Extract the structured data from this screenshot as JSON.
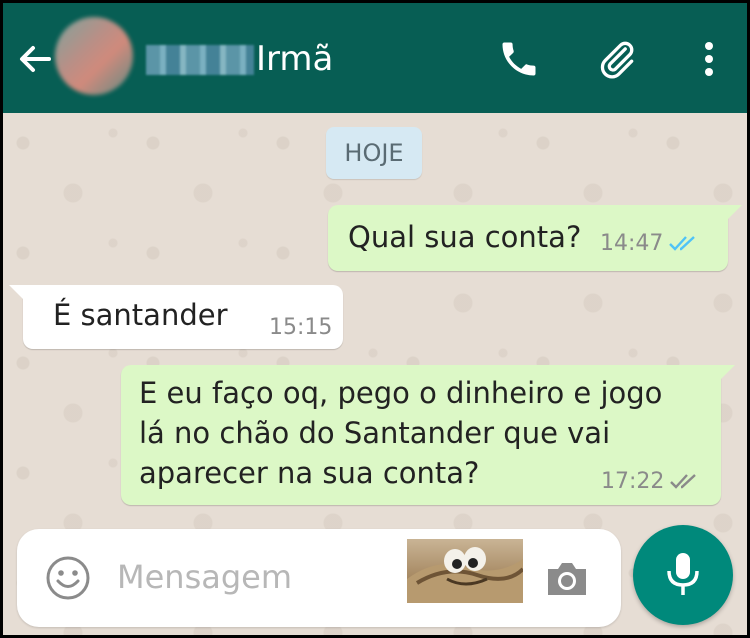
{
  "header": {
    "contact_name": "Irmã",
    "back_icon": "back-arrow-icon",
    "actions": [
      "phone-icon",
      "paperclip-icon",
      "more-vert-icon"
    ],
    "background": "#075e54"
  },
  "chat": {
    "date_label": "HOJE",
    "messages": [
      {
        "direction": "outgoing",
        "text": "Qual sua conta?",
        "time": "14:47",
        "status": "read"
      },
      {
        "direction": "incoming",
        "text": "É  santander",
        "time": "15:15"
      },
      {
        "direction": "outgoing",
        "text": "E eu faço oq, pego o dinheiro e jogo\nlá no chão do Santander que vai\naparecer na sua conta?",
        "time": "17:22",
        "status": "delivered"
      }
    ]
  },
  "composer": {
    "placeholder": "Mensagem",
    "value": "",
    "icons": [
      "emoji-icon",
      "camera-icon",
      "mic-icon"
    ]
  },
  "colors": {
    "outgoing_bubble": "#dcf8c6",
    "incoming_bubble": "#ffffff",
    "read_ticks": "#4fc3f7",
    "accent": "#00897b"
  }
}
